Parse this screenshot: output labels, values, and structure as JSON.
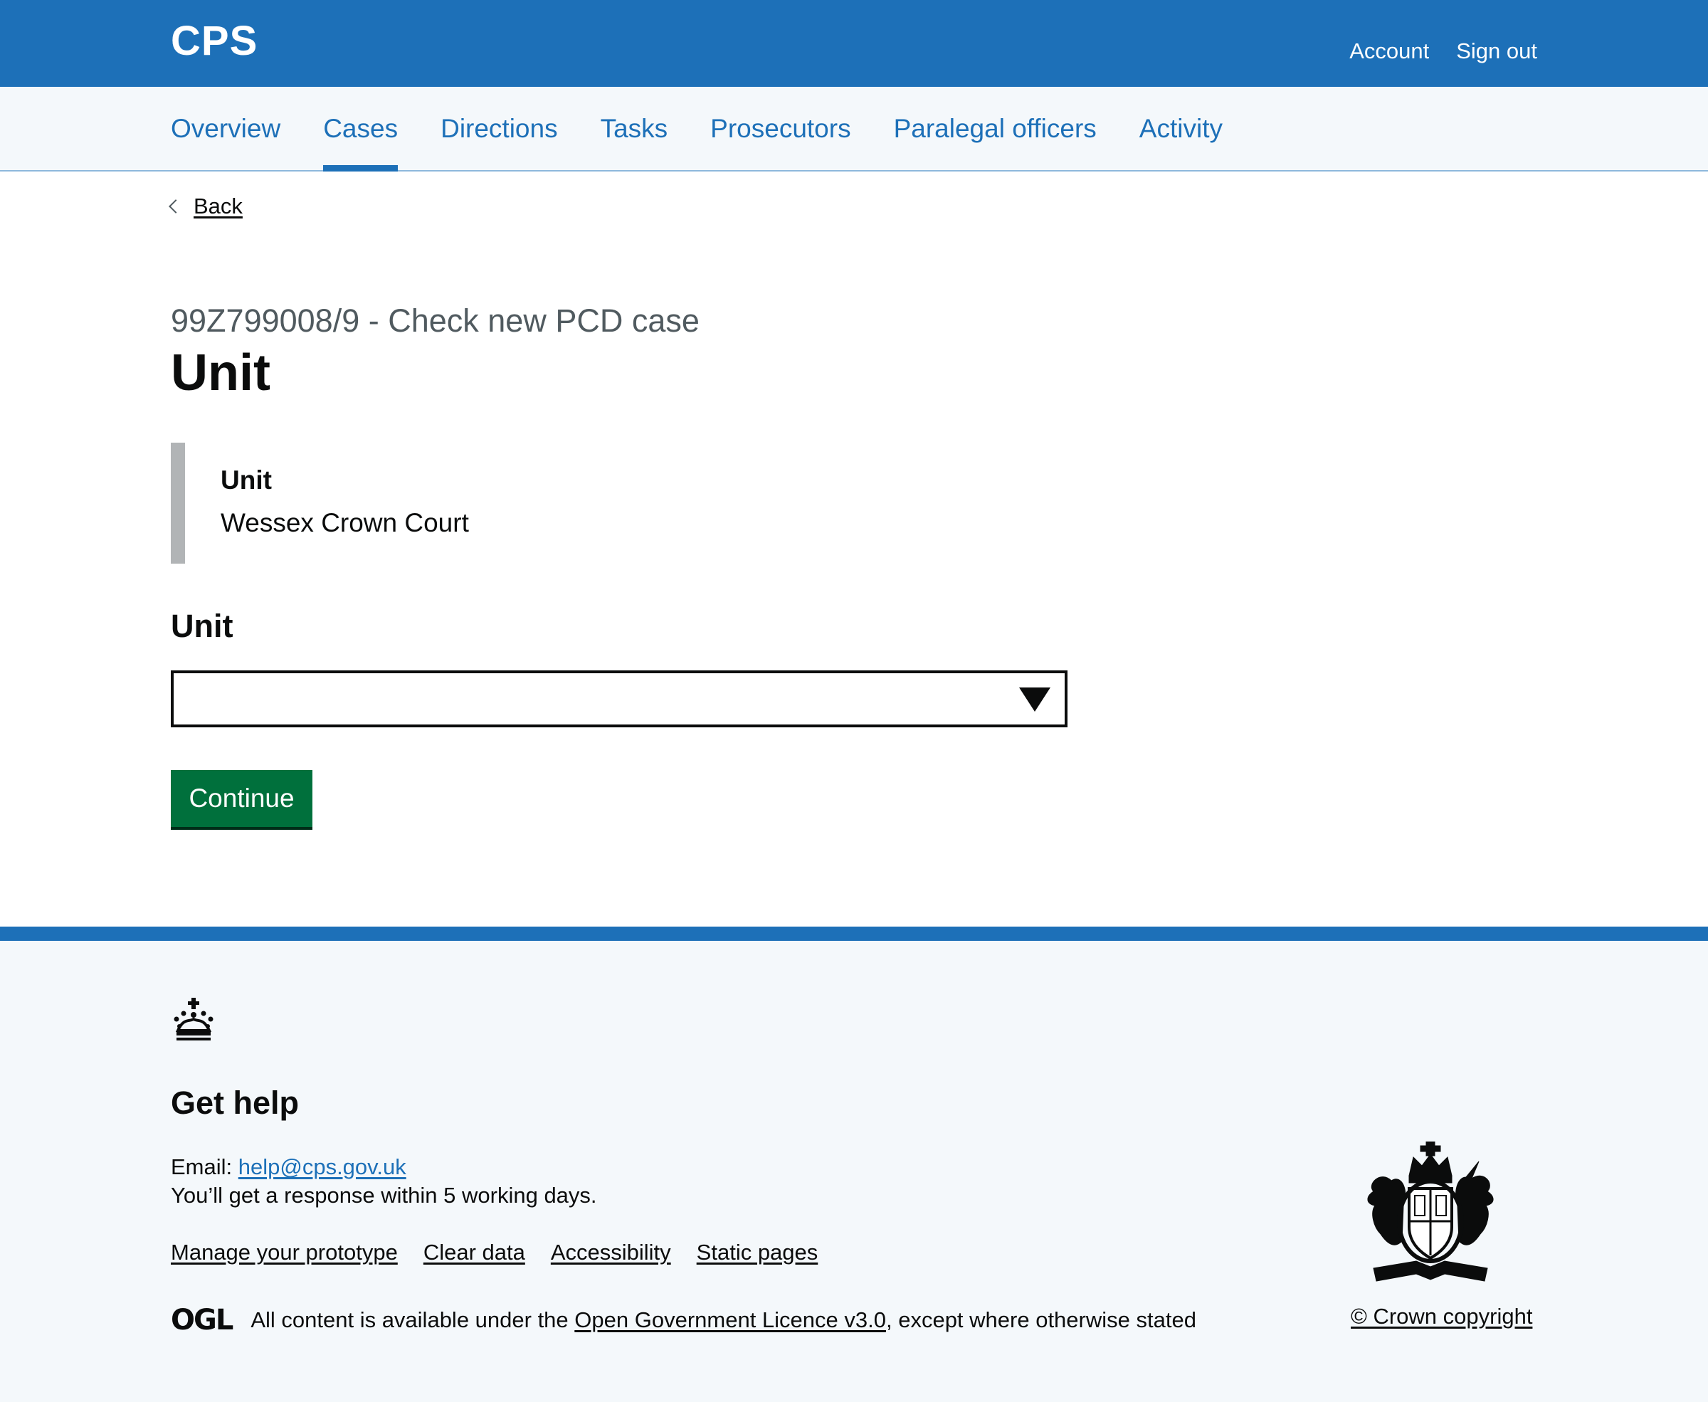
{
  "header": {
    "service_name": "CPS",
    "account_label": "Account",
    "signout_label": "Sign out"
  },
  "nav": {
    "items": [
      {
        "label": "Overview"
      },
      {
        "label": "Cases",
        "active": true
      },
      {
        "label": "Directions"
      },
      {
        "label": "Tasks"
      },
      {
        "label": "Prosecutors"
      },
      {
        "label": "Paralegal officers"
      },
      {
        "label": "Activity"
      }
    ]
  },
  "back_label": "Back",
  "page": {
    "caption": "99Z799008/9 - Check new PCD case",
    "title": "Unit"
  },
  "inset": {
    "label": "Unit",
    "value": "Wessex Crown Court"
  },
  "form": {
    "label": "Unit",
    "selected_value": "",
    "continue_label": "Continue"
  },
  "footer": {
    "get_help": "Get help",
    "email_prefix": "Email: ",
    "email": "help@cps.gov.uk",
    "response": "You’ll get a response within 5 working days.",
    "links": [
      "Manage your prototype",
      "Clear data",
      "Accessibility",
      "Static pages"
    ],
    "ogl_logo": "OGL",
    "licence_prefix": "All content is available under the ",
    "licence_link": "Open Government Licence v3.0",
    "licence_suffix": ", except where otherwise stated",
    "copyright": "© Crown copyright"
  },
  "colors": {
    "brand_blue": "#1d70b8",
    "button_green": "#00703c",
    "text": "#0b0c0c",
    "secondary_text": "#505a5f",
    "inset_border": "#b1b4b6",
    "nav_background": "#f4f8fb"
  },
  "icons": {
    "back": "chevron-left-icon",
    "select": "triangle-down-icon",
    "crown": "crown-icon",
    "crest": "royal-coat-of-arms"
  }
}
